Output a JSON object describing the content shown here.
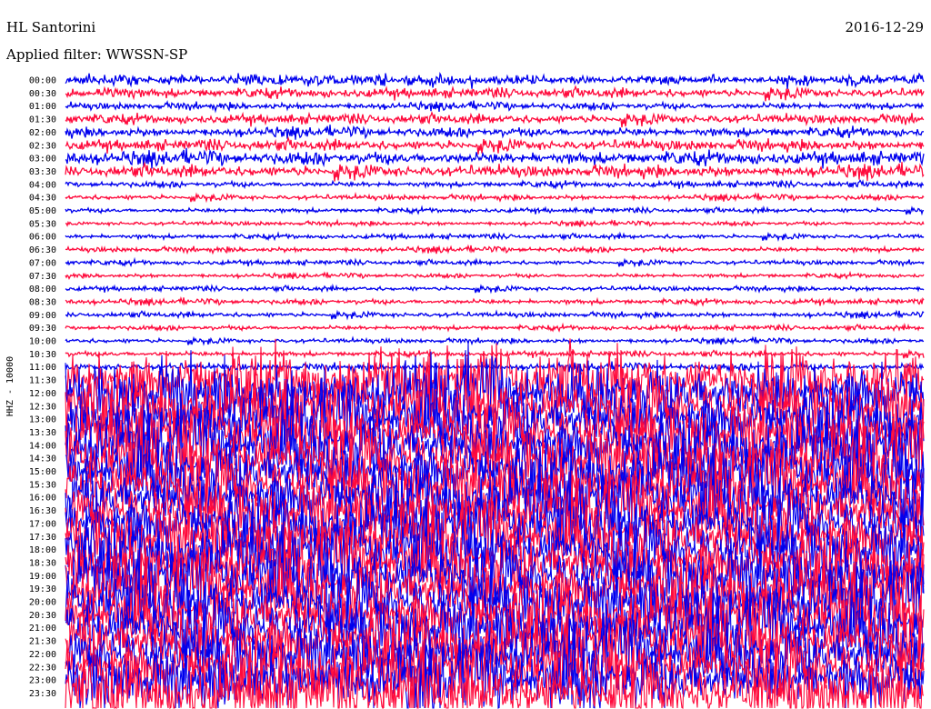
{
  "header": {
    "station": "HL Santorini",
    "date": "2016-12-29",
    "filter": "Applied filter: WWSSN-SP"
  },
  "chart_data": {
    "type": "line",
    "title": "HL Santorini",
    "subtitle": "Applied filter: WWSSN-SP",
    "ylabel": "HHZ - 10000",
    "xlabel": "",
    "row_labels": [
      "00:00",
      "00:30",
      "01:00",
      "01:30",
      "02:00",
      "02:30",
      "03:00",
      "03:30",
      "04:00",
      "04:30",
      "05:00",
      "05:30",
      "06:00",
      "06:30",
      "07:00",
      "07:30",
      "08:00",
      "08:30",
      "09:00",
      "09:30",
      "10:00",
      "10:30",
      "11:00",
      "11:30",
      "12:00",
      "12:30",
      "13:00",
      "13:30",
      "14:00",
      "14:30",
      "15:00",
      "15:30",
      "16:00",
      "16:30",
      "17:00",
      "17:30",
      "18:00",
      "18:30",
      "19:00",
      "19:30",
      "20:00",
      "20:30",
      "21:00",
      "21:30",
      "22:00",
      "22:30",
      "23:00",
      "23:30"
    ],
    "trace_colors": [
      "#0000ee",
      "#ff0a3c"
    ],
    "relative_amplitude": [
      0.45,
      0.4,
      0.3,
      0.4,
      0.4,
      0.45,
      0.55,
      0.5,
      0.25,
      0.22,
      0.2,
      0.18,
      0.2,
      0.22,
      0.2,
      0.18,
      0.2,
      0.22,
      0.22,
      0.2,
      0.2,
      0.22,
      0.3,
      2.6,
      2.8,
      2.8,
      2.7,
      2.7,
      2.8,
      2.9,
      2.8,
      2.8,
      2.8,
      2.7,
      2.7,
      2.8,
      2.7,
      2.8,
      2.8,
      2.8,
      2.7,
      2.7,
      2.8,
      2.8,
      2.7,
      2.8,
      2.8,
      2.9
    ],
    "grid": false
  }
}
